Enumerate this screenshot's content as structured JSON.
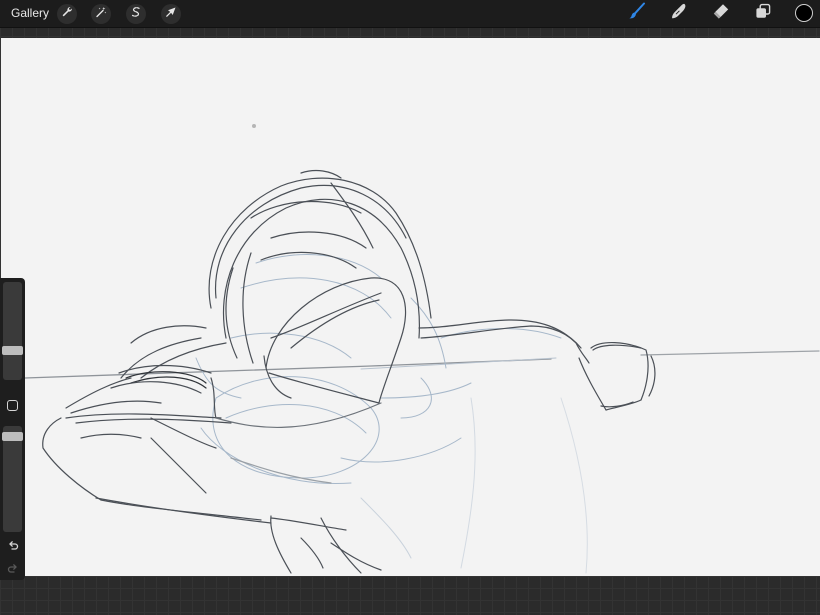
{
  "topbar": {
    "gallery_label": "Gallery",
    "left_tools": [
      {
        "name": "actions",
        "icon": "wrench-icon"
      },
      {
        "name": "adjustments",
        "icon": "magic-wand-icon"
      },
      {
        "name": "selection",
        "icon": "selection-s-icon"
      },
      {
        "name": "transform",
        "icon": "arrow-cursor-icon"
      }
    ],
    "right_tools": [
      {
        "name": "brush",
        "icon": "brush-icon",
        "active": true,
        "color": "#2f86e6"
      },
      {
        "name": "smudge",
        "icon": "smudge-finger-icon",
        "active": false
      },
      {
        "name": "eraser",
        "icon": "eraser-icon",
        "active": false
      },
      {
        "name": "layers",
        "icon": "layers-icon",
        "active": false
      }
    ],
    "current_color": "#000000"
  },
  "sidebar": {
    "brush_size_level": 0.65,
    "opacity_level": 0.92,
    "modify_icon": "square-icon",
    "undo_icon": "undo-icon",
    "redo_icon": "redo-icon"
  },
  "colors": {
    "toolbar_bg": "#1c1c1c",
    "canvas_bg": "#f3f3f3",
    "sketch_dark": "#4a4f55",
    "sketch_blue": "#9fb1c4"
  }
}
